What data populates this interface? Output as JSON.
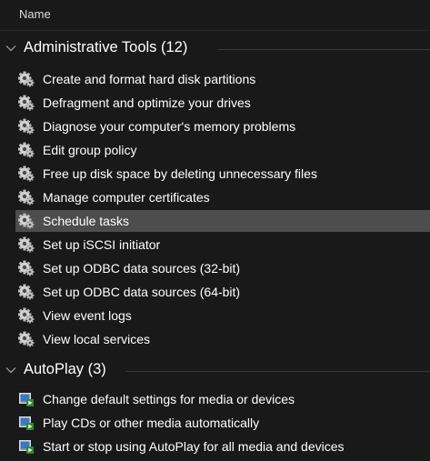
{
  "column_header": {
    "name": "Name"
  },
  "groups": [
    {
      "title": "Administrative Tools (12)",
      "icon": "gear-icon",
      "items": [
        {
          "label": "Create and format hard disk partitions"
        },
        {
          "label": "Defragment and optimize your drives"
        },
        {
          "label": "Diagnose your computer's memory problems"
        },
        {
          "label": "Edit group policy"
        },
        {
          "label": "Free up disk space by deleting unnecessary files"
        },
        {
          "label": "Manage computer certificates"
        },
        {
          "label": "Schedule tasks",
          "selected": true
        },
        {
          "label": "Set up iSCSI initiator"
        },
        {
          "label": "Set up ODBC data sources (32-bit)"
        },
        {
          "label": "Set up ODBC data sources (64-bit)"
        },
        {
          "label": "View event logs"
        },
        {
          "label": "View local services"
        }
      ]
    },
    {
      "title": "AutoPlay (3)",
      "icon": "autoplay-icon",
      "items": [
        {
          "label": "Change default settings for media or devices"
        },
        {
          "label": "Play CDs or other media automatically"
        },
        {
          "label": "Start or stop using AutoPlay for all media and devices"
        }
      ]
    }
  ],
  "colors": {
    "background": "#191919",
    "selected_row": "#4d4d4d",
    "text": "#ffffff"
  }
}
